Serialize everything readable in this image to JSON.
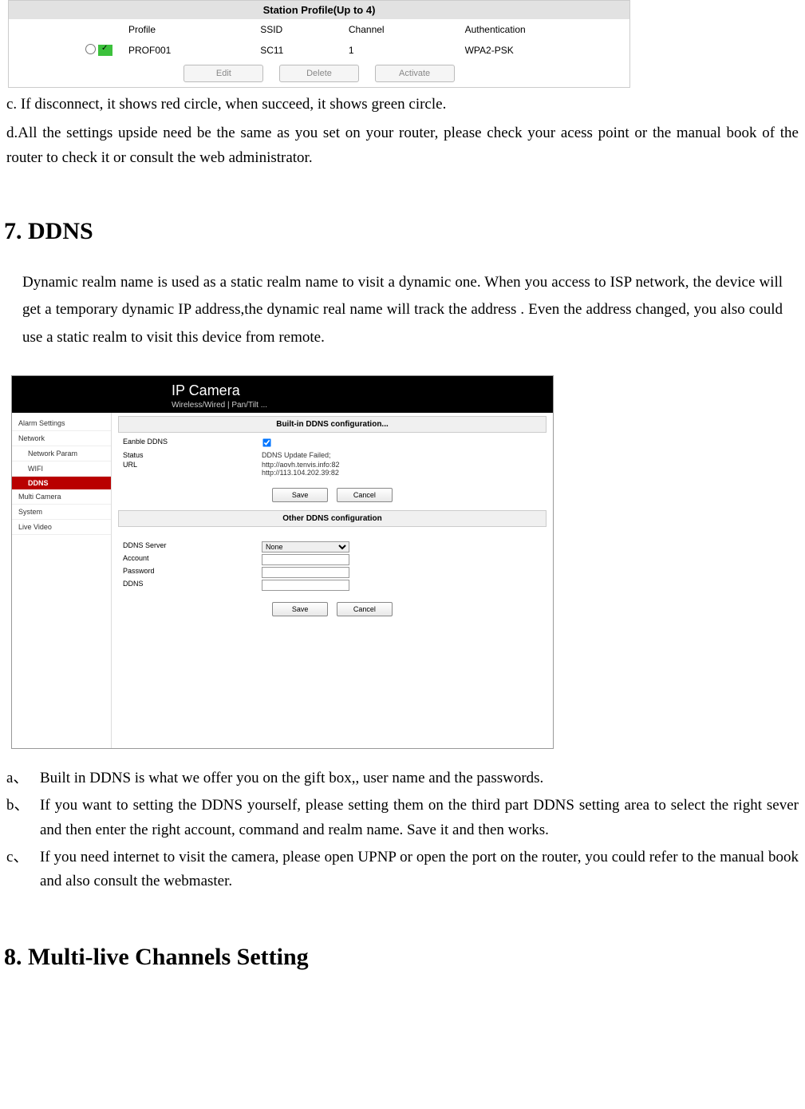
{
  "station": {
    "title": "Station Profile(Up to 4)",
    "headers": {
      "profile": "Profile",
      "ssid": "SSID",
      "channel": "Channel",
      "auth": "Authentication"
    },
    "row": {
      "profile": "PROF001",
      "ssid": "SC11",
      "channel": "1",
      "auth": "WPA2-PSK"
    },
    "buttons": {
      "edit": "Edit",
      "delete": "Delete",
      "activate": "Activate"
    }
  },
  "para_c": "c. If disconnect, it shows red circle, when succeed, it shows green circle.",
  "para_d": "d.All the settings upside need be the same as you set on your router, please check your acess point or the manual book of the router to check it or consult the web administrator.",
  "heading7": "7. DDNS",
  "ddns_intro": "Dynamic realm name is used as a static realm name to visit a dynamic one. When you access to ISP network, the device will get a temporary dynamic IP address,the dynamic real name   will track the address . Even the address changed, you also could use a static realm to visit this device from remote.",
  "ipcam": {
    "title": "IP Camera",
    "subtitle": "Wireless/Wired | Pan/Tilt ...",
    "sidebar": {
      "alarm": "Alarm Settings",
      "network": "Network",
      "network_param": "Network Param",
      "wifi": "WIFI",
      "ddns": "DDNS",
      "multi": "Multi Camera",
      "system": "System",
      "live": "Live Video"
    },
    "builtin": {
      "title": "Built-in DDNS configuration...",
      "enable_label": "Eanble DDNS",
      "status_label": "Status",
      "status_value": "DDNS Update Failed;",
      "url_label": "URL",
      "url_line1": "http://aovh.tenvis.info:82",
      "url_line2": "http://113.104.202.39:82"
    },
    "other": {
      "title": "Other DDNS configuration",
      "server_label": "DDNS Server",
      "server_value": "None",
      "account_label": "Account",
      "password_label": "Password",
      "ddns_label": "DDNS"
    },
    "buttons": {
      "save": "Save",
      "cancel": "Cancel"
    }
  },
  "list": {
    "a": {
      "marker": "a、",
      "text": "Built in DDNS is what we offer you on the gift box,, user name and the passwords."
    },
    "b": {
      "marker": "b、",
      "text": "If you want to setting the DDNS yourself, please setting them on the third part DDNS setting area to select the right sever and then enter the right account, command and realm name. Save it and then works."
    },
    "c": {
      "marker": "c、",
      "text": "If you need internet to visit the camera, please open UPNP or open the port on the router, you could refer to the manual book and also consult the webmaster."
    }
  },
  "heading8": "8. Multi-live Channels Setting"
}
